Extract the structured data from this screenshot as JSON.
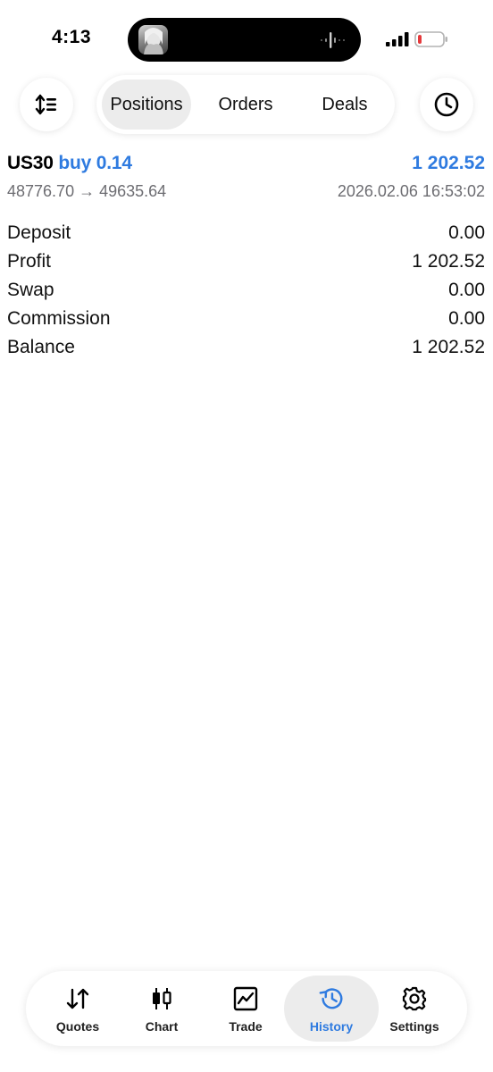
{
  "status_bar": {
    "time": "4:13"
  },
  "header": {
    "segments": [
      {
        "label": "Positions",
        "active": true
      },
      {
        "label": "Orders",
        "active": false
      },
      {
        "label": "Deals",
        "active": false
      }
    ],
    "left_icon": "sort-icon",
    "right_icon": "clock-icon"
  },
  "position": {
    "symbol": "US30",
    "side_volume": "buy 0.14",
    "profit": "1 202.52",
    "prices": "48776.70 → 49635.64",
    "datetime": "2026.02.06 16:53:02"
  },
  "summary": [
    {
      "label": "Deposit",
      "value": "0.00"
    },
    {
      "label": "Profit",
      "value": "1 202.52"
    },
    {
      "label": "Swap",
      "value": "0.00"
    },
    {
      "label": "Commission",
      "value": "0.00"
    },
    {
      "label": "Balance",
      "value": "1 202.52"
    }
  ],
  "tabbar": {
    "tabs": [
      {
        "label": "Quotes",
        "icon": "quotes-icon",
        "active": false
      },
      {
        "label": "Chart",
        "icon": "chart-icon",
        "active": false
      },
      {
        "label": "Trade",
        "icon": "trade-icon",
        "active": false
      },
      {
        "label": "History",
        "icon": "history-icon",
        "active": true
      },
      {
        "label": "Settings",
        "icon": "settings-icon",
        "active": false
      }
    ]
  },
  "colors": {
    "accent": "#2f7be0",
    "secondary_text": "#6d6d72",
    "active_pill": "#ececec",
    "battery_low": "#e5393b"
  }
}
